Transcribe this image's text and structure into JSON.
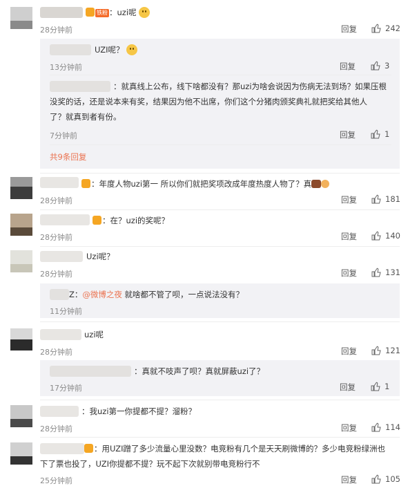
{
  "comments": [
    {
      "text": "：uzi呢",
      "time": "28分钟前",
      "reply": "回复",
      "likes": "242"
    },
    {
      "text": "：年度人物uzi第一 所以你们就把奖项改成年度热度人物了？真",
      "time": "28分钟前",
      "reply": "回复",
      "likes": "181"
    },
    {
      "text": "：在？uzi的奖呢？",
      "time": "28分钟前",
      "reply": "回复",
      "likes": "140"
    },
    {
      "text": "Uzi呢？",
      "time": "28分钟前",
      "reply": "回复",
      "likes": "131"
    },
    {
      "text": "uzi呢",
      "time": "28分钟前",
      "reply": "回复",
      "likes": "121"
    },
    {
      "text": "：我uzi第一你提都不提？溜粉？",
      "time": "28分钟前",
      "reply": "回复",
      "likes": "114"
    },
    {
      "text_line1": "：用UZI蹭了多少流量心里没数？电竞粉有几个是天天刷微博的？多少电竞粉绿洲也",
      "text_line2": "下了票也投了，UZI你提都不提？玩不起下次就别带电竞粉行不",
      "time": "25分钟前",
      "reply": "回复",
      "likes": "105"
    }
  ],
  "replies": [
    {
      "text": "UZI呢？",
      "time": "13分钟前",
      "reply": "回复",
      "likes": "3"
    },
    {
      "line1": "：就真线上公布，线下啥都没有？那uzi为啥会说因为伤病无法到场？如果压根",
      "line2": "没奖的话，还是说本来有奖，结果因为他不出席，你们这个分猪肉颁奖典礼就把奖给其他人",
      "line3": "了？就真到者有份。",
      "time": "7分钟前",
      "reply": "回复",
      "likes": "1"
    },
    {
      "prefix": "Z：",
      "mention": "@微博之夜",
      "text": " 就啥都不管了呗，一点说法没有？",
      "time": "11分钟前"
    },
    {
      "text": "：真就不吱声了呗？真就屏蔽uzi了？",
      "time": "17分钟前",
      "reply": "回复",
      "likes": "1"
    }
  ],
  "more_replies": "共9条回复",
  "icons": {
    "like": "thumb-up-icon",
    "emoji": "smile-emoji-icon"
  },
  "colors": {
    "accent": "#eb7350",
    "muted": "#8a8a8a",
    "nested_bg": "#f2f2f5"
  }
}
